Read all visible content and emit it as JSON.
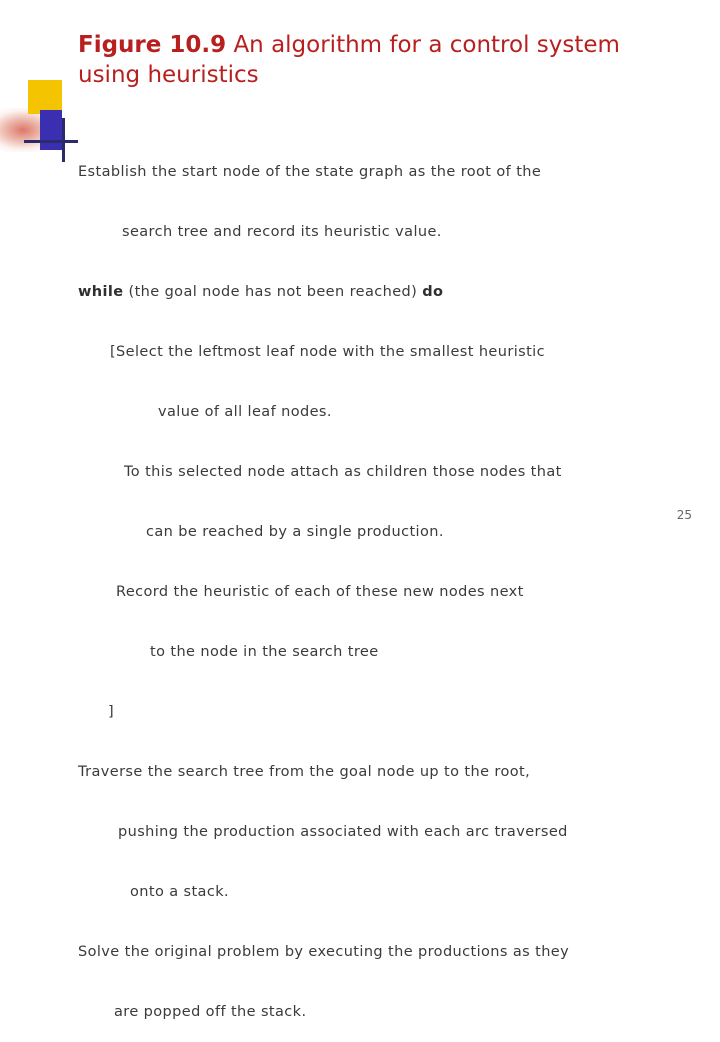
{
  "slide": {
    "title": {
      "label": "Figure 10.9",
      "rest": "  An algorithm for a control system using heuristics"
    },
    "page_number": "25",
    "colors": {
      "title": "#b81f1f",
      "body": "#3b3b3b",
      "ornament_yellow": "#f5c400",
      "ornament_blue": "#3a2fb0",
      "ornament_line": "#2b2b6b"
    },
    "algorithm": {
      "lines": [
        "Establish the start node of the state graph as the root of the",
        "search tree and record its heuristic value.",
        "while (the goal node has not been reached) do",
        "[Select the leftmost leaf node with the smallest heuristic",
        "value of all leaf nodes.",
        "To this selected node attach as children those nodes that",
        "can be reached by a single production.",
        "Record the heuristic of each of these new nodes next",
        "to the node in the search tree",
        "]",
        "Traverse the search tree from the goal node up to the root,",
        "pushing the production associated with each arc traversed",
        "onto a stack.",
        "Solve the original problem by executing the productions as they",
        "are popped off the stack."
      ],
      "keywords": {
        "while": "while",
        "do": "do",
        "while_rest": " (the goal node has not been reached) "
      }
    }
  }
}
